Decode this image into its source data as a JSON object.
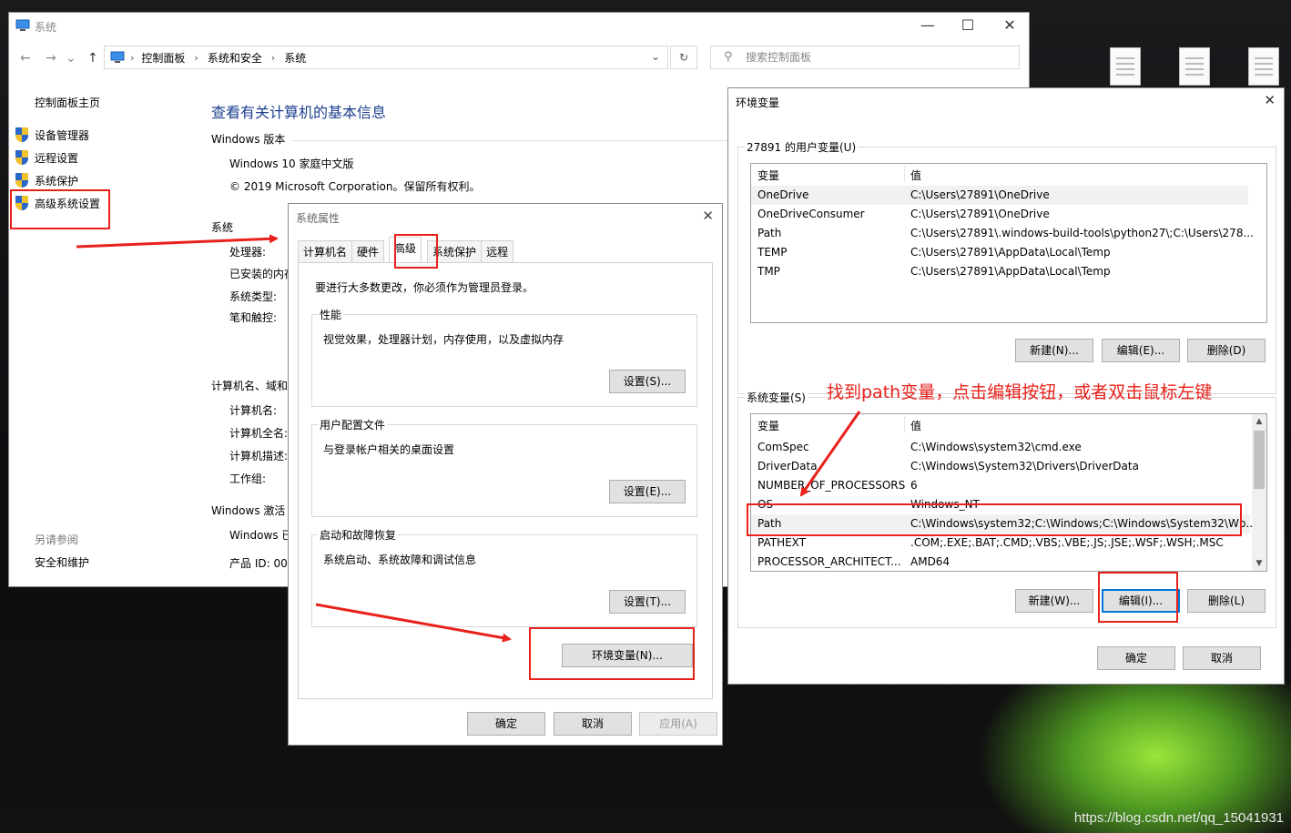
{
  "desktop": {
    "watermark": "https://blog.csdn.net/qq_15041931"
  },
  "system_window": {
    "title": "系统",
    "breadcrumbs": [
      "控制面板",
      "系统和安全",
      "系统"
    ],
    "search_placeholder": "搜索控制面板",
    "left_nav": {
      "home": "控制面板主页",
      "items": [
        "设备管理器",
        "远程设置",
        "系统保护",
        "高级系统设置"
      ],
      "see_also_title": "另请参阅",
      "see_also": [
        "安全和维护"
      ]
    },
    "main": {
      "title": "查看有关计算机的基本信息",
      "windows_edition_header": "Windows 版本",
      "edition": "Windows 10 家庭中文版",
      "copyright": "© 2019 Microsoft Corporation。保留所有权利。",
      "system_header": "系统",
      "system_labels": [
        "处理器:",
        "已安装的内存",
        "系统类型:",
        "笔和触控:"
      ],
      "computer_header": "计算机名、域和",
      "computer_labels": [
        "计算机名:",
        "计算机全名:",
        "计算机描述:",
        "工作组:"
      ],
      "activation_header": "Windows 激活",
      "activation_line": "Windows 已",
      "product_id": "产品 ID: 00"
    }
  },
  "props_dialog": {
    "title": "系统属性",
    "tabs": [
      "计算机名",
      "硬件",
      "高级",
      "系统保护",
      "远程"
    ],
    "admin_note": "要进行大多数更改，你必须作为管理员登录。",
    "performance": {
      "title": "性能",
      "desc": "视觉效果，处理器计划，内存使用，以及虚拟内存",
      "button": "设置(S)..."
    },
    "profiles": {
      "title": "用户配置文件",
      "desc": "与登录帐户相关的桌面设置",
      "button": "设置(E)..."
    },
    "startup": {
      "title": "启动和故障恢复",
      "desc": "系统启动、系统故障和调试信息",
      "button": "设置(T)..."
    },
    "env_button": "环境变量(N)...",
    "ok": "确定",
    "cancel": "取消",
    "apply": "应用(A)"
  },
  "env_dialog": {
    "title": "环境变量",
    "user_section": "27891 的用户变量(U)",
    "col_var": "变量",
    "col_val": "值",
    "user_vars": [
      [
        "OneDrive",
        "C:\\Users\\27891\\OneDrive"
      ],
      [
        "OneDriveConsumer",
        "C:\\Users\\27891\\OneDrive"
      ],
      [
        "Path",
        "C:\\Users\\27891\\.windows-build-tools\\python27\\;C:\\Users\\278..."
      ],
      [
        "TEMP",
        "C:\\Users\\27891\\AppData\\Local\\Temp"
      ],
      [
        "TMP",
        "C:\\Users\\27891\\AppData\\Local\\Temp"
      ]
    ],
    "user_buttons": [
      "新建(N)...",
      "编辑(E)...",
      "删除(D)"
    ],
    "system_section": "系统变量(S)",
    "system_vars": [
      [
        "ComSpec",
        "C:\\Windows\\system32\\cmd.exe"
      ],
      [
        "DriverData",
        "C:\\Windows\\System32\\Drivers\\DriverData"
      ],
      [
        "NUMBER_OF_PROCESSORS",
        "6"
      ],
      [
        "OS",
        "Windows_NT"
      ],
      [
        "Path",
        "C:\\Windows\\system32;C:\\Windows;C:\\Windows\\System32\\Wb..."
      ],
      [
        "PATHEXT",
        ".COM;.EXE;.BAT;.CMD;.VBS;.VBE;.JS;.JSE;.WSF;.WSH;.MSC"
      ],
      [
        "PROCESSOR_ARCHITECT...",
        "AMD64"
      ]
    ],
    "system_buttons": [
      "新建(W)...",
      "编辑(I)...",
      "删除(L)"
    ],
    "ok": "确定",
    "cancel": "取消"
  },
  "annotation": {
    "text": "找到path变量，点击编辑按钮，或者双击鼠标左键",
    "color": "#e8211b"
  }
}
